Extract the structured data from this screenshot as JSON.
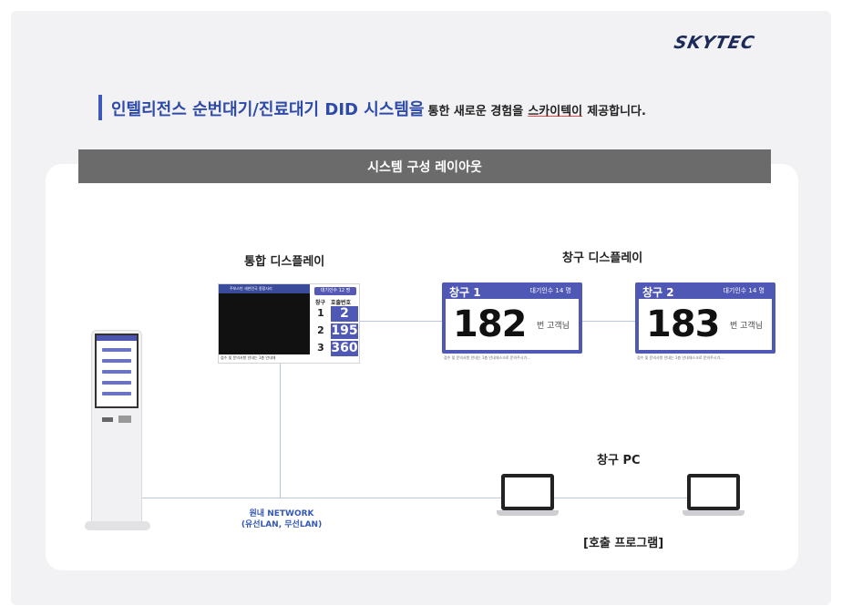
{
  "brand": {
    "logo": "SKYTEC"
  },
  "headline": {
    "main": "인텔리전스 순번대기/진료대기 DID 시스템을",
    "rest": "통한 새로운 경험을",
    "company": "스카이텍이",
    "tail": "제공합니다."
  },
  "banner": {
    "title": "시스템 구성 레이아웃"
  },
  "integrated_display": {
    "label": "통합 디스플레이",
    "top_text": "주보스빈 세한민국 종합사리",
    "wait_text": "대기인수 12 명",
    "col_window": "창구",
    "col_number": "호출번호",
    "rows": [
      {
        "window": "1",
        "number": "2"
      },
      {
        "window": "2",
        "number": "195"
      },
      {
        "window": "3",
        "number": "360"
      }
    ],
    "footer": "접수 및 문의사항 안내는 1층 안내데"
  },
  "window_display_label": "창구 디스플레이",
  "windows": [
    {
      "title": "창구 1",
      "wait": "대기인수 14 명",
      "number": "182",
      "suffix": "번 고객님",
      "footer": "접수 및 문의사항 안내는 1층 안내데스크로 문의주시기..."
    },
    {
      "title": "창구 2",
      "wait": "대기인수 14 명",
      "number": "183",
      "suffix": "번 고객님",
      "footer": "접수 및 문의사항 안내는 1층 안내데스크로 문의주시기..."
    }
  ],
  "pc": {
    "label": "창구 PC",
    "program": "[호출 프로그램]"
  },
  "network": {
    "line1": "원내 NETWORK",
    "line2": "(유선LAN, 무선LAN)"
  },
  "colors": {
    "accent": "#3f58b7",
    "display": "#5058b5",
    "banner": "#6b6b6b"
  }
}
